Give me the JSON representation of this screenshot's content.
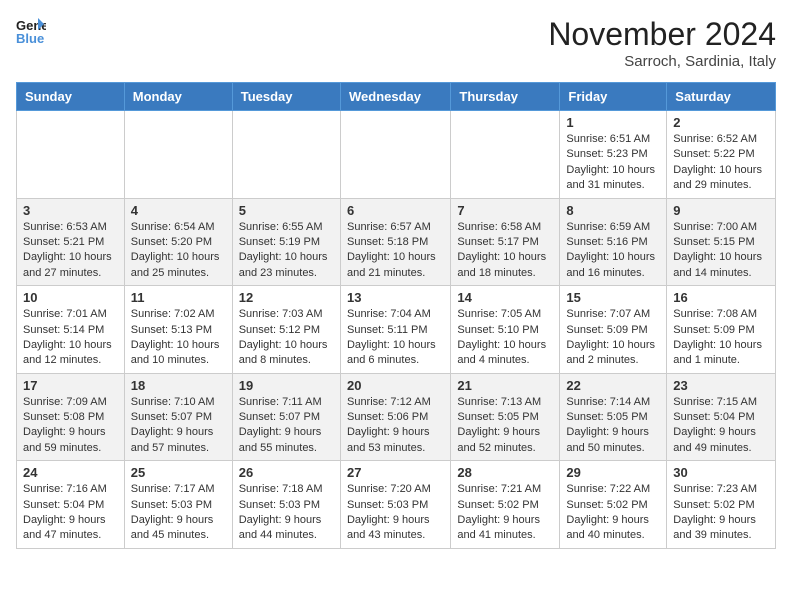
{
  "header": {
    "logo_line1": "General",
    "logo_line2": "Blue",
    "month_title": "November 2024",
    "location": "Sarroch, Sardinia, Italy"
  },
  "weekdays": [
    "Sunday",
    "Monday",
    "Tuesday",
    "Wednesday",
    "Thursday",
    "Friday",
    "Saturday"
  ],
  "weeks": [
    [
      {
        "day": "",
        "info": ""
      },
      {
        "day": "",
        "info": ""
      },
      {
        "day": "",
        "info": ""
      },
      {
        "day": "",
        "info": ""
      },
      {
        "day": "",
        "info": ""
      },
      {
        "day": "1",
        "info": "Sunrise: 6:51 AM\nSunset: 5:23 PM\nDaylight: 10 hours and 31 minutes."
      },
      {
        "day": "2",
        "info": "Sunrise: 6:52 AM\nSunset: 5:22 PM\nDaylight: 10 hours and 29 minutes."
      }
    ],
    [
      {
        "day": "3",
        "info": "Sunrise: 6:53 AM\nSunset: 5:21 PM\nDaylight: 10 hours and 27 minutes."
      },
      {
        "day": "4",
        "info": "Sunrise: 6:54 AM\nSunset: 5:20 PM\nDaylight: 10 hours and 25 minutes."
      },
      {
        "day": "5",
        "info": "Sunrise: 6:55 AM\nSunset: 5:19 PM\nDaylight: 10 hours and 23 minutes."
      },
      {
        "day": "6",
        "info": "Sunrise: 6:57 AM\nSunset: 5:18 PM\nDaylight: 10 hours and 21 minutes."
      },
      {
        "day": "7",
        "info": "Sunrise: 6:58 AM\nSunset: 5:17 PM\nDaylight: 10 hours and 18 minutes."
      },
      {
        "day": "8",
        "info": "Sunrise: 6:59 AM\nSunset: 5:16 PM\nDaylight: 10 hours and 16 minutes."
      },
      {
        "day": "9",
        "info": "Sunrise: 7:00 AM\nSunset: 5:15 PM\nDaylight: 10 hours and 14 minutes."
      }
    ],
    [
      {
        "day": "10",
        "info": "Sunrise: 7:01 AM\nSunset: 5:14 PM\nDaylight: 10 hours and 12 minutes."
      },
      {
        "day": "11",
        "info": "Sunrise: 7:02 AM\nSunset: 5:13 PM\nDaylight: 10 hours and 10 minutes."
      },
      {
        "day": "12",
        "info": "Sunrise: 7:03 AM\nSunset: 5:12 PM\nDaylight: 10 hours and 8 minutes."
      },
      {
        "day": "13",
        "info": "Sunrise: 7:04 AM\nSunset: 5:11 PM\nDaylight: 10 hours and 6 minutes."
      },
      {
        "day": "14",
        "info": "Sunrise: 7:05 AM\nSunset: 5:10 PM\nDaylight: 10 hours and 4 minutes."
      },
      {
        "day": "15",
        "info": "Sunrise: 7:07 AM\nSunset: 5:09 PM\nDaylight: 10 hours and 2 minutes."
      },
      {
        "day": "16",
        "info": "Sunrise: 7:08 AM\nSunset: 5:09 PM\nDaylight: 10 hours and 1 minute."
      }
    ],
    [
      {
        "day": "17",
        "info": "Sunrise: 7:09 AM\nSunset: 5:08 PM\nDaylight: 9 hours and 59 minutes."
      },
      {
        "day": "18",
        "info": "Sunrise: 7:10 AM\nSunset: 5:07 PM\nDaylight: 9 hours and 57 minutes."
      },
      {
        "day": "19",
        "info": "Sunrise: 7:11 AM\nSunset: 5:07 PM\nDaylight: 9 hours and 55 minutes."
      },
      {
        "day": "20",
        "info": "Sunrise: 7:12 AM\nSunset: 5:06 PM\nDaylight: 9 hours and 53 minutes."
      },
      {
        "day": "21",
        "info": "Sunrise: 7:13 AM\nSunset: 5:05 PM\nDaylight: 9 hours and 52 minutes."
      },
      {
        "day": "22",
        "info": "Sunrise: 7:14 AM\nSunset: 5:05 PM\nDaylight: 9 hours and 50 minutes."
      },
      {
        "day": "23",
        "info": "Sunrise: 7:15 AM\nSunset: 5:04 PM\nDaylight: 9 hours and 49 minutes."
      }
    ],
    [
      {
        "day": "24",
        "info": "Sunrise: 7:16 AM\nSunset: 5:04 PM\nDaylight: 9 hours and 47 minutes."
      },
      {
        "day": "25",
        "info": "Sunrise: 7:17 AM\nSunset: 5:03 PM\nDaylight: 9 hours and 45 minutes."
      },
      {
        "day": "26",
        "info": "Sunrise: 7:18 AM\nSunset: 5:03 PM\nDaylight: 9 hours and 44 minutes."
      },
      {
        "day": "27",
        "info": "Sunrise: 7:20 AM\nSunset: 5:03 PM\nDaylight: 9 hours and 43 minutes."
      },
      {
        "day": "28",
        "info": "Sunrise: 7:21 AM\nSunset: 5:02 PM\nDaylight: 9 hours and 41 minutes."
      },
      {
        "day": "29",
        "info": "Sunrise: 7:22 AM\nSunset: 5:02 PM\nDaylight: 9 hours and 40 minutes."
      },
      {
        "day": "30",
        "info": "Sunrise: 7:23 AM\nSunset: 5:02 PM\nDaylight: 9 hours and 39 minutes."
      }
    ]
  ]
}
